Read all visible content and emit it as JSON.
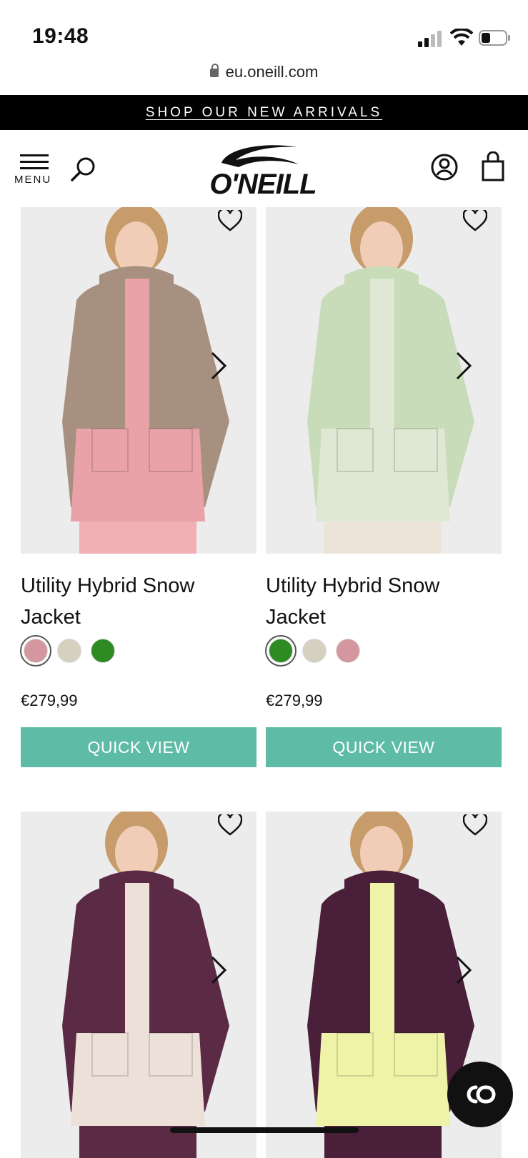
{
  "status_bar": {
    "time": "19:48"
  },
  "browser": {
    "url": "eu.oneill.com"
  },
  "promo": {
    "text": "SHOP OUR NEW ARRIVALS"
  },
  "header": {
    "menu_label": "MENU",
    "brand": "O'NEILL"
  },
  "products": [
    {
      "name": "Utility Hybrid Snow Jacket",
      "price": "€279,99",
      "quick_view": "QUICK VIEW",
      "swatches": [
        "#d4979f",
        "#d6d0c0",
        "#2e8a22"
      ],
      "selected_swatch": 0,
      "jacket_colors": {
        "body": "#e8a2a8",
        "top": "#a89080",
        "pants": "#f0b0b4"
      }
    },
    {
      "name": "Utility Hybrid Snow Jacket",
      "price": "€279,99",
      "quick_view": "QUICK VIEW",
      "swatches": [
        "#2e8a22",
        "#d6d0c0",
        "#d4979f"
      ],
      "selected_swatch": 0,
      "jacket_colors": {
        "body": "#dfe8d4",
        "top": "#c9dcb9",
        "pants": "#ece4d8"
      }
    },
    {
      "name": "",
      "price": "",
      "quick_view": "",
      "swatches": [],
      "jacket_colors": {
        "body": "#ece0d8",
        "top": "#5b2a45",
        "pants": "#5b2a45"
      }
    },
    {
      "name": "",
      "price": "",
      "quick_view": "",
      "swatches": [],
      "jacket_colors": {
        "body": "#eef3a8",
        "top": "#4a1f3a",
        "pants": "#4a1f3a"
      }
    }
  ],
  "colors": {
    "accent": "#5dbba6",
    "promo_bg": "#000000"
  },
  "icons": [
    "menu-icon",
    "search-icon",
    "account-icon",
    "bag-icon",
    "heart-icon",
    "chevron-right-icon",
    "chat-icon"
  ]
}
